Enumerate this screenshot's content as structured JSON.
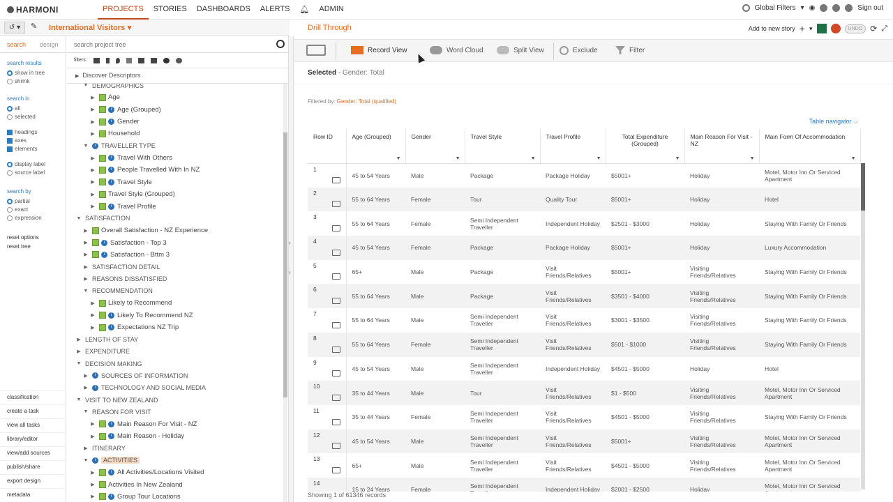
{
  "app": {
    "logo": "HARMONI"
  },
  "topnav": [
    "PROJECTS",
    "STORIES",
    "DASHBOARDS",
    "ALERTS",
    "ADMIN"
  ],
  "topright": {
    "global_filters": "Global Filters",
    "sign_out": "Sign out"
  },
  "project": {
    "name": "International Visitors ♥"
  },
  "left": {
    "tabs": [
      "search",
      "design"
    ],
    "search_results_h": "search results",
    "show_in_tree": "show in tree",
    "shrink": "shrink",
    "search_in_h": "search in",
    "all": "all",
    "selected": "selected",
    "headings": "headings",
    "axes": "axes",
    "elements": "elements",
    "display_label": "display label",
    "source_label": "source label",
    "search_by_h": "search by",
    "partial": "partial",
    "exact": "exact",
    "expression": "expression",
    "reset_options": "reset options",
    "reset_tree": "reset tree",
    "bottom": [
      "classification",
      "create a task",
      "view all tasks",
      "library/editor",
      "view/add sources",
      "publish/share",
      "export design",
      "metadata"
    ]
  },
  "tree": {
    "search_placeholder": "search project tree",
    "filters_label": "filters:",
    "discover": "Discover Descriptors",
    "rows": [
      {
        "label": "DEMOGRAPHICS",
        "indent": 2,
        "type": "cat",
        "tri": "▼"
      },
      {
        "label": "Age",
        "indent": 3,
        "type": "sq",
        "tri": "▶"
      },
      {
        "label": "Age (Grouped)",
        "indent": 3,
        "type": "sqi",
        "tri": "▶"
      },
      {
        "label": "Gender",
        "indent": 3,
        "type": "sqi",
        "tri": "▶"
      },
      {
        "label": "Household",
        "indent": 3,
        "type": "sq",
        "tri": "▶"
      },
      {
        "label": "TRAVELLER TYPE",
        "indent": 2,
        "type": "icat",
        "tri": "▼"
      },
      {
        "label": "Travel With Others",
        "indent": 3,
        "type": "sqi",
        "tri": "▶"
      },
      {
        "label": "People Travelled With In NZ",
        "indent": 3,
        "type": "sqi",
        "tri": "▶"
      },
      {
        "label": "Travel Style",
        "indent": 3,
        "type": "sqi",
        "tri": "▶"
      },
      {
        "label": "Travel Style (Grouped)",
        "indent": 3,
        "type": "sq",
        "tri": "▶"
      },
      {
        "label": "Travel Profile",
        "indent": 3,
        "type": "sqi",
        "tri": "▶"
      },
      {
        "label": "SATISFACTION",
        "indent": 1,
        "type": "cat",
        "tri": "▼"
      },
      {
        "label": "Overall Satisfaction - NZ Experience",
        "indent": 2,
        "type": "sq",
        "tri": "▶"
      },
      {
        "label": "Satisfaction - Top 3",
        "indent": 2,
        "type": "sqi",
        "tri": "▶"
      },
      {
        "label": "Satisfaction - Bttm 3",
        "indent": 2,
        "type": "sqi",
        "tri": "▶"
      },
      {
        "label": "SATISFACTION DETAIL",
        "indent": 2,
        "type": "cat",
        "tri": "▶"
      },
      {
        "label": "REASONS DISSATISFIED",
        "indent": 2,
        "type": "cat",
        "tri": "▶"
      },
      {
        "label": "RECOMMENDATION",
        "indent": 2,
        "type": "cat",
        "tri": "▼"
      },
      {
        "label": "Likely to Recommend",
        "indent": 3,
        "type": "sq",
        "tri": "▶"
      },
      {
        "label": "Likely To Recommend NZ",
        "indent": 3,
        "type": "sqi",
        "tri": "▶"
      },
      {
        "label": "Expectations NZ Trip",
        "indent": 3,
        "type": "sqi",
        "tri": "▶"
      },
      {
        "label": "LENGTH OF STAY",
        "indent": 1,
        "type": "cat",
        "tri": "▶"
      },
      {
        "label": "EXPENDITURE",
        "indent": 1,
        "type": "cat",
        "tri": "▶"
      },
      {
        "label": "DECISION MAKING",
        "indent": 1,
        "type": "cat",
        "tri": "▼"
      },
      {
        "label": "SOURCES OF INFORMATION",
        "indent": 2,
        "type": "icat",
        "tri": "▶"
      },
      {
        "label": "TECHNOLOGY AND SOCIAL MEDIA",
        "indent": 2,
        "type": "icat",
        "tri": "▶"
      },
      {
        "label": "VISIT TO NEW ZEALAND",
        "indent": 1,
        "type": "cat",
        "tri": "▼"
      },
      {
        "label": "REASON FOR VISIT",
        "indent": 2,
        "type": "cat",
        "tri": "▼"
      },
      {
        "label": "Main Reason For Visit - NZ",
        "indent": 3,
        "type": "sqi",
        "tri": "▶"
      },
      {
        "label": "Main Reason - Holiday",
        "indent": 3,
        "type": "sqi",
        "tri": "▶"
      },
      {
        "label": "ITINERARY",
        "indent": 2,
        "type": "cat",
        "tri": "▶"
      },
      {
        "label": "ACTIVITIES",
        "indent": 2,
        "type": "icat-hl",
        "tri": "▼"
      },
      {
        "label": "All Activities/Locations Visited",
        "indent": 3,
        "type": "sqi",
        "tri": "▶"
      },
      {
        "label": "Activities In New Zealand",
        "indent": 3,
        "type": "sq",
        "tri": "▶"
      },
      {
        "label": "Group Tour Locations",
        "indent": 3,
        "type": "sqi",
        "tri": "▶"
      }
    ]
  },
  "main": {
    "title": "Drill Through",
    "add_to_story": "Add to new story",
    "undo": "UNDO",
    "tools": [
      "Record View",
      "Word Cloud",
      "Split View",
      "Exclude",
      "Filter"
    ],
    "selected_label": "Selected",
    "selected_value": " - Gender: Total",
    "filtered_label": "Filtered by: ",
    "filtered_value": "Gender: Total (qualified)",
    "table_navigator": "Table navigator ⌵",
    "showing": "Showing 1 of 61346 records"
  },
  "table": {
    "columns": [
      "Row ID",
      "Age (Grouped)",
      "Gender",
      "Travel Style",
      "Travel Profile",
      "Total Expenditure (Grouped)",
      "Main Reason For Visit - NZ",
      "Main Form Of Accommodation"
    ],
    "rows": [
      [
        "1",
        "45 to 54 Years",
        "Male",
        "Package",
        "Package Holiday",
        "$5001+",
        "Holiday",
        "Motel, Motor Inn Or Serviced Apartment"
      ],
      [
        "2",
        "55 to 64 Years",
        "Female",
        "Tour",
        "Quality Tour",
        "$5001+",
        "Holiday",
        "Hotel"
      ],
      [
        "3",
        "55 to 64 Years",
        "Female",
        "Semi Independent Traveller",
        "Independent Holiday",
        "$2501 - $3000",
        "Holiday",
        "Staying With Family Or Friends"
      ],
      [
        "4",
        "45 to 54 Years",
        "Female",
        "Package",
        "Package Holiday",
        "$5001+",
        "Holiday",
        "Luxury Accommodation"
      ],
      [
        "5",
        "65+",
        "Male",
        "Package",
        "Visit Friends/Relatives",
        "$5001+",
        "Visiting Friends/Relatives",
        "Staying With Family Or Friends"
      ],
      [
        "6",
        "55 to 64 Years",
        "Male",
        "Package",
        "Visit Friends/Relatives",
        "$3501 - $4000",
        "Visiting Friends/Relatives",
        "Staying With Family Or Friends"
      ],
      [
        "7",
        "55 to 64 Years",
        "Male",
        "Semi Independent Traveller",
        "Visit Friends/Relatives",
        "$3001 - $3500",
        "Visiting Friends/Relatives",
        "Staying With Family Or Friends"
      ],
      [
        "8",
        "55 to 64 Years",
        "Female",
        "Semi Independent Traveller",
        "Visit Friends/Relatives",
        "$501 - $1000",
        "Visiting Friends/Relatives",
        "Staying With Family Or Friends"
      ],
      [
        "9",
        "45 to 54 Years",
        "Male",
        "Semi Independent Traveller",
        "Independent Holiday",
        "$4501 - $5000",
        "Holiday",
        "Hotel"
      ],
      [
        "10",
        "35 to 44 Years",
        "Male",
        "Tour",
        "Visit Friends/Relatives",
        "$1 - $500",
        "Visiting Friends/Relatives",
        "Motel, Motor Inn Or Serviced Apartment"
      ],
      [
        "11",
        "35 to 44 Years",
        "Female",
        "Semi Independent Traveller",
        "Visit Friends/Relatives",
        "$4501 - $5000",
        "Visiting Friends/Relatives",
        "Staying With Family Or Friends"
      ],
      [
        "12",
        "45 to 54 Years",
        "Male",
        "Semi Independent Traveller",
        "Visit Friends/Relatives",
        "$5001+",
        "Visiting Friends/Relatives",
        "Motel, Motor Inn Or Serviced Apartment"
      ],
      [
        "13",
        "65+",
        "Male",
        "Semi Independent Traveller",
        "Visit Friends/Relatives",
        "$4501 - $5000",
        "Visiting Friends/Relatives",
        "Motel, Motor Inn Or Serviced Apartment"
      ],
      [
        "14",
        "15 to 24 Years",
        "Female",
        "Semi Independent Traveller",
        "Independent Holiday",
        "$2001 - $2500",
        "Holiday",
        "Motel, Motor Inn Or Serviced Apartment"
      ]
    ]
  }
}
